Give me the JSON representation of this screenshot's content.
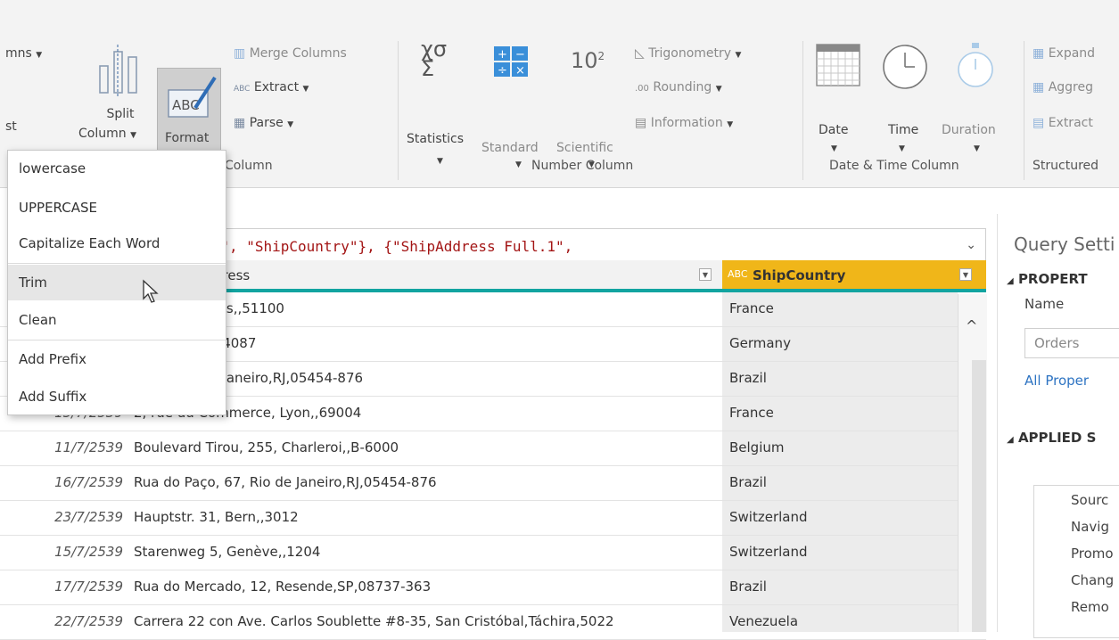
{
  "ribbon": {
    "columns_partial": "mns",
    "list_partial": "st",
    "split_column": {
      "line1": "Split",
      "line2": "Column"
    },
    "format": {
      "label": "Format",
      "icon_text": "ABC"
    },
    "merge_columns": "Merge Columns",
    "extract": "Extract",
    "parse": "Parse",
    "text_column_partial": "Column",
    "statistics": "Statistics",
    "standard": "Standard",
    "scientific": "Scientific",
    "scientific_exp": "10",
    "scientific_sup": "2",
    "trigonometry": "Trigonometry",
    "rounding": "Rounding",
    "information": "Information",
    "number_column": "Number Column",
    "date": "Date",
    "time": "Time",
    "duration": "Duration",
    "date_time_column": "Date & Time Column",
    "expand_partial": "Expand",
    "aggregate_partial": "Aggreg",
    "extract_values_partial": "Extract",
    "structured_partial": "Structured"
  },
  "format_menu": {
    "items": [
      "lowercase",
      "UPPERCASE",
      "Capitalize Each Word",
      "Trim",
      "Clean",
      "Add Prefix",
      "Add Suffix"
    ]
  },
  "formula": {
    "text": "ess Full.2\", \"ShipCountry\"}, {\"ShipAddress Full.1\","
  },
  "grid": {
    "col_address_partial": "dress",
    "col_country": "ShipCountry",
    "col_country_type": "ABC",
    "rows": [
      {
        "date": "",
        "address": "Abbaye, Reims,,51100",
        "country": "France"
      },
      {
        "date": "",
        "address": "8, Münster,,44087",
        "country": "Germany"
      },
      {
        "date": "",
        "address": "o, 67, Rio de Janeiro,RJ,05454-876",
        "country": "Brazil"
      },
      {
        "date": "15/7/2539",
        "address": "2, rue du Commerce, Lyon,,69004",
        "country": "France"
      },
      {
        "date": "11/7/2539",
        "address": "Boulevard Tirou, 255, Charleroi,,B-6000",
        "country": "Belgium"
      },
      {
        "date": "16/7/2539",
        "address": "Rua do Paço, 67, Rio de Janeiro,RJ,05454-876",
        "country": "Brazil"
      },
      {
        "date": "23/7/2539",
        "address": "Hauptstr. 31, Bern,,3012",
        "country": "Switzerland"
      },
      {
        "date": "15/7/2539",
        "address": "Starenweg 5, Genève,,1204",
        "country": "Switzerland"
      },
      {
        "date": "17/7/2539",
        "address": "Rua do Mercado, 12, Resende,SP,08737-363",
        "country": "Brazil"
      },
      {
        "date": "22/7/2539",
        "address": "Carrera 22 con Ave. Carlos Soublette #8-35, San Cristóbal,Táchira,5022",
        "country": "Venezuela"
      }
    ]
  },
  "query_settings": {
    "title": "Query Setti",
    "properties": "PROPERT",
    "name_label": "Name",
    "name_value": "Orders",
    "all_properties": "All Proper",
    "applied_steps": "APPLIED S",
    "steps": [
      "Sourc",
      "Navig",
      "Promo",
      "Chang",
      "Remo"
    ]
  },
  "colors": {
    "accent_teal": "#12a4a0",
    "header_highlight": "#f0b619",
    "link_blue": "#2d73c2"
  }
}
